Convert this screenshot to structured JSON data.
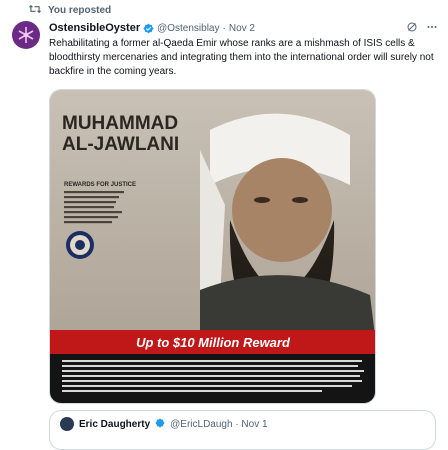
{
  "repost": {
    "label": "You reposted"
  },
  "tweet": {
    "display_name": "OstensibleOyster",
    "handle": "@Ostensiblay",
    "separator": "·",
    "time": "Nov 2",
    "text": "Rehabilitating a former al-Qaeda Emir whose ranks are a mishmash of ISIS cells & bloodthirsty mercenaries and integrating them into the international order will surely not backfire in the coming years."
  },
  "poster": {
    "name_line1": "MUHAMMAD",
    "name_line2": "AL-JAWLANI",
    "rewards_title": "REWARDS FOR JUSTICE",
    "reward_banner": "Up to $10 Million Reward"
  },
  "quote": {
    "display_name": "Eric Daugherty",
    "meta": "@EricLDaugh · Nov 1"
  },
  "colors": {
    "accent": "#1d9bf0",
    "banner_red": "#c01818",
    "avatar": "#6b2a86"
  }
}
